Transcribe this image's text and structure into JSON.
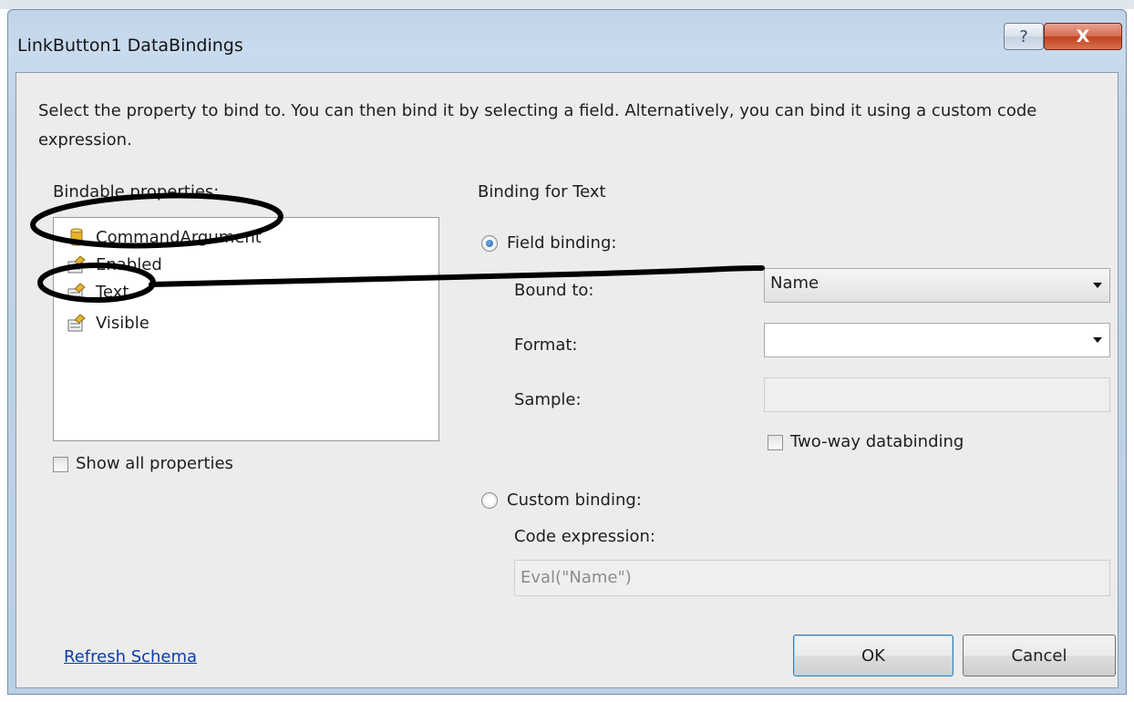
{
  "window": {
    "title": "LinkButton1 DataBindings",
    "help_glyph": "?",
    "close_glyph": "X"
  },
  "description": "Select the property to bind to. You can then bind it by selecting a field. Alternatively, you can bind it using a custom code expression.",
  "bindable": {
    "label": "Bindable properties:",
    "items": [
      {
        "label": "CommandArgument",
        "icon": "database-cylinder-icon"
      },
      {
        "label": "Enabled",
        "icon": "property-icon"
      },
      {
        "label": "Text",
        "icon": "property-icon"
      },
      {
        "label": "Visible",
        "icon": "property-icon"
      }
    ],
    "show_all_label": "Show all properties"
  },
  "binding": {
    "heading": "Binding for Text",
    "field_binding_label": "Field binding:",
    "bound_to_label": "Bound to:",
    "bound_to_value": "Name",
    "format_label": "Format:",
    "format_value": "",
    "sample_label": "Sample:",
    "sample_value": "",
    "two_way_label": "Two-way databinding",
    "custom_binding_label": "Custom binding:",
    "code_expression_label": "Code expression:",
    "code_expression_value": "Eval(\"Name\")"
  },
  "footer": {
    "refresh_link": "Refresh Schema",
    "ok_label": "OK",
    "cancel_label": "Cancel"
  },
  "colors": {
    "title_bar": "#c9dbee",
    "close_button": "#c1411f",
    "link": "#0a3ca8",
    "dialog_face": "#ececec"
  }
}
